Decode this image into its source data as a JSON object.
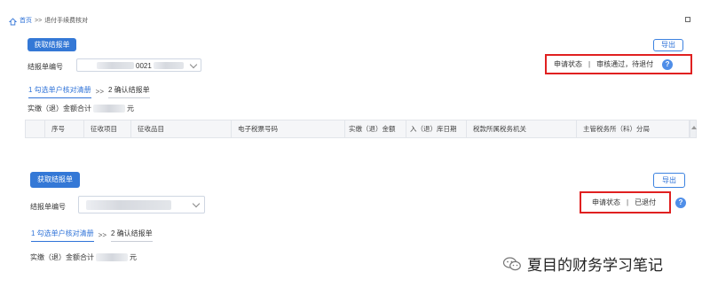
{
  "breadcrumb": {
    "home": "首页",
    "separator": ">>",
    "current": "退付手续费核对"
  },
  "panels": [
    {
      "fetch_button": "获取结报单",
      "export_button": "导出",
      "settlement_label": "结报单编号",
      "settlement_value": "0021",
      "status_label": "申请状态",
      "status_divider": "|",
      "status_value": "审核通过，待退付",
      "help_icon": "question-circle-icon",
      "steps": {
        "step1": "1 勾选单户核对清册",
        "separator": ">>",
        "step2": "2 确认结报单"
      },
      "amount_label": "实缴（退）金额合计",
      "amount_unit": "元",
      "table": {
        "columns": [
          "序号",
          "征收项目",
          "征收品目",
          "电子税票号码",
          "实缴（退）金额",
          "入（退）库日期",
          "税款所属税务机关",
          "主管税务所（科）分局"
        ]
      }
    },
    {
      "fetch_button": "获取结报单",
      "export_button": "导出",
      "settlement_label": "结报单编号",
      "status_label": "申请状态",
      "status_divider": "|",
      "status_value": "已退付",
      "help_icon": "question-circle-icon",
      "steps": {
        "step1": "1 勾选单户核对清册",
        "separator": ">>",
        "step2": "2 确认结报单"
      },
      "amount_label": "实缴（退）金额合计",
      "amount_unit": "元"
    }
  ],
  "watermark": {
    "text": "夏目的财务学习笔记",
    "icon": "wechat-icon"
  },
  "colors": {
    "primary": "#3478d6",
    "highlight": "#e02020",
    "link": "#2f73d8"
  }
}
